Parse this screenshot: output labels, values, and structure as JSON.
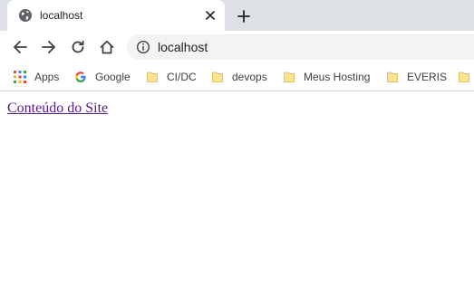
{
  "tab": {
    "title": "localhost",
    "favicon": "globe-icon",
    "close": "close-icon"
  },
  "new_tab": "plus-icon",
  "toolbar": {
    "back": "arrow-left-icon",
    "forward": "arrow-right-icon",
    "reload": "reload-icon",
    "home": "home-icon"
  },
  "omnibox": {
    "info_icon": "info-icon",
    "url": "localhost"
  },
  "bookmarks": [
    {
      "label": "Apps",
      "icon": "apps-grid-icon"
    },
    {
      "label": "Google",
      "icon": "google-icon"
    },
    {
      "label": "CI/DC",
      "icon": "folder-icon"
    },
    {
      "label": "devops",
      "icon": "folder-icon"
    },
    {
      "label": "Meus Hosting",
      "icon": "folder-icon"
    },
    {
      "label": "EVERIS",
      "icon": "folder-icon"
    }
  ],
  "page": {
    "link_text": "Conteúdo do Site"
  },
  "colors": {
    "tabstrip_bg": "#dee1e6",
    "omnibox_bg": "#f1f3f4",
    "visited_link": "#551a8b",
    "folder_yellow": "#fde293"
  }
}
